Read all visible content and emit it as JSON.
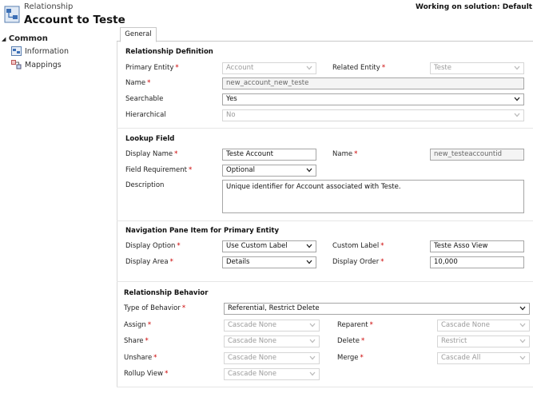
{
  "header": {
    "subtitle": "Relationship",
    "title": "Account to Teste",
    "solution": "Working on solution: Default Soluti"
  },
  "nav": {
    "section": "Common",
    "items": [
      {
        "label": "Information",
        "icon": "information-icon"
      },
      {
        "label": "Mappings",
        "icon": "mappings-icon"
      }
    ]
  },
  "tab": {
    "label": "General"
  },
  "relationship_definition": {
    "title": "Relationship Definition",
    "primary_entity": {
      "label": "Primary Entity",
      "value": "Account"
    },
    "related_entity": {
      "label": "Related Entity",
      "value": "Teste"
    },
    "name": {
      "label": "Name",
      "value": "new_account_new_teste"
    },
    "searchable": {
      "label": "Searchable",
      "value": "Yes"
    },
    "hierarchical": {
      "label": "Hierarchical",
      "value": "No"
    }
  },
  "lookup_field": {
    "title": "Lookup Field",
    "display_name": {
      "label": "Display Name",
      "value": "Teste Account"
    },
    "name": {
      "label": "Name",
      "value": "new_testeaccountid"
    },
    "field_requirement": {
      "label": "Field Requirement",
      "value": "Optional"
    },
    "description": {
      "label": "Description",
      "value": "Unique identifier for Account associated with Teste."
    }
  },
  "navigation_pane": {
    "title": "Navigation Pane Item for Primary Entity",
    "display_option": {
      "label": "Display Option",
      "value": "Use Custom Label"
    },
    "custom_label": {
      "label": "Custom Label",
      "value": "Teste Asso View"
    },
    "display_area": {
      "label": "Display Area",
      "value": "Details"
    },
    "display_order": {
      "label": "Display Order",
      "value": "10,000"
    }
  },
  "relationship_behavior": {
    "title": "Relationship Behavior",
    "type": {
      "label": "Type of Behavior",
      "value": "Referential, Restrict Delete"
    },
    "assign": {
      "label": "Assign",
      "value": "Cascade None"
    },
    "reparent": {
      "label": "Reparent",
      "value": "Cascade None"
    },
    "share": {
      "label": "Share",
      "value": "Cascade None"
    },
    "delete": {
      "label": "Delete",
      "value": "Restrict"
    },
    "unshare": {
      "label": "Unshare",
      "value": "Cascade None"
    },
    "merge": {
      "label": "Merge",
      "value": "Cascade All"
    },
    "rollup": {
      "label": "Rollup View",
      "value": "Cascade None"
    }
  },
  "required_marker": "*"
}
